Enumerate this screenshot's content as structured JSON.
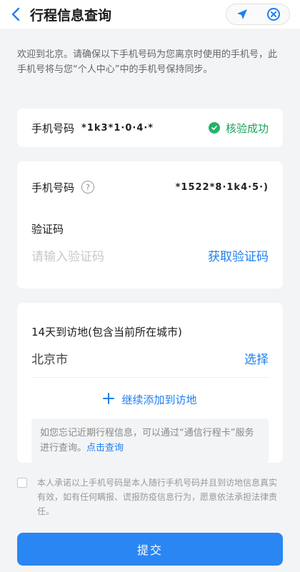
{
  "header": {
    "title": "行程信息查询",
    "icons": [
      "back-icon",
      "location-arrow-icon",
      "close-icon"
    ]
  },
  "notice": "欢迎到北京。请确保以下手机号码为您离京时使用的手机号，此手机号将与您“个人中心”中的手机号保持同步。",
  "verified": {
    "label": "手机号码",
    "masked_value": "*1k3*1·0·4·*",
    "status": "核验成功"
  },
  "phone_form": {
    "label": "手机号码",
    "masked_value": "*1522*8·1k4·5·)",
    "code_label": "验证码",
    "code_placeholder": "请输入验证码",
    "get_code": "获取验证码"
  },
  "destinations": {
    "label": "14天到访地(包含当前所在城市)",
    "city": "北京市",
    "select": "选择",
    "add": "继续添加到访地",
    "info_text": "如您忘记近期行程信息，可以通过“通信行程卡”服务进行查询。",
    "info_link": "点击查询"
  },
  "pledge": "本人承诺以上手机号码是本人随行手机号码并且到访地信息真实有效，如有任何瞒报、谎报防疫信息行为，愿意依法承担法律责任。",
  "submit": "提交",
  "colors": {
    "accent": "#1f7ff0",
    "success": "#22b36a",
    "button": "#2a86f3",
    "background": "#f3f4f6"
  }
}
